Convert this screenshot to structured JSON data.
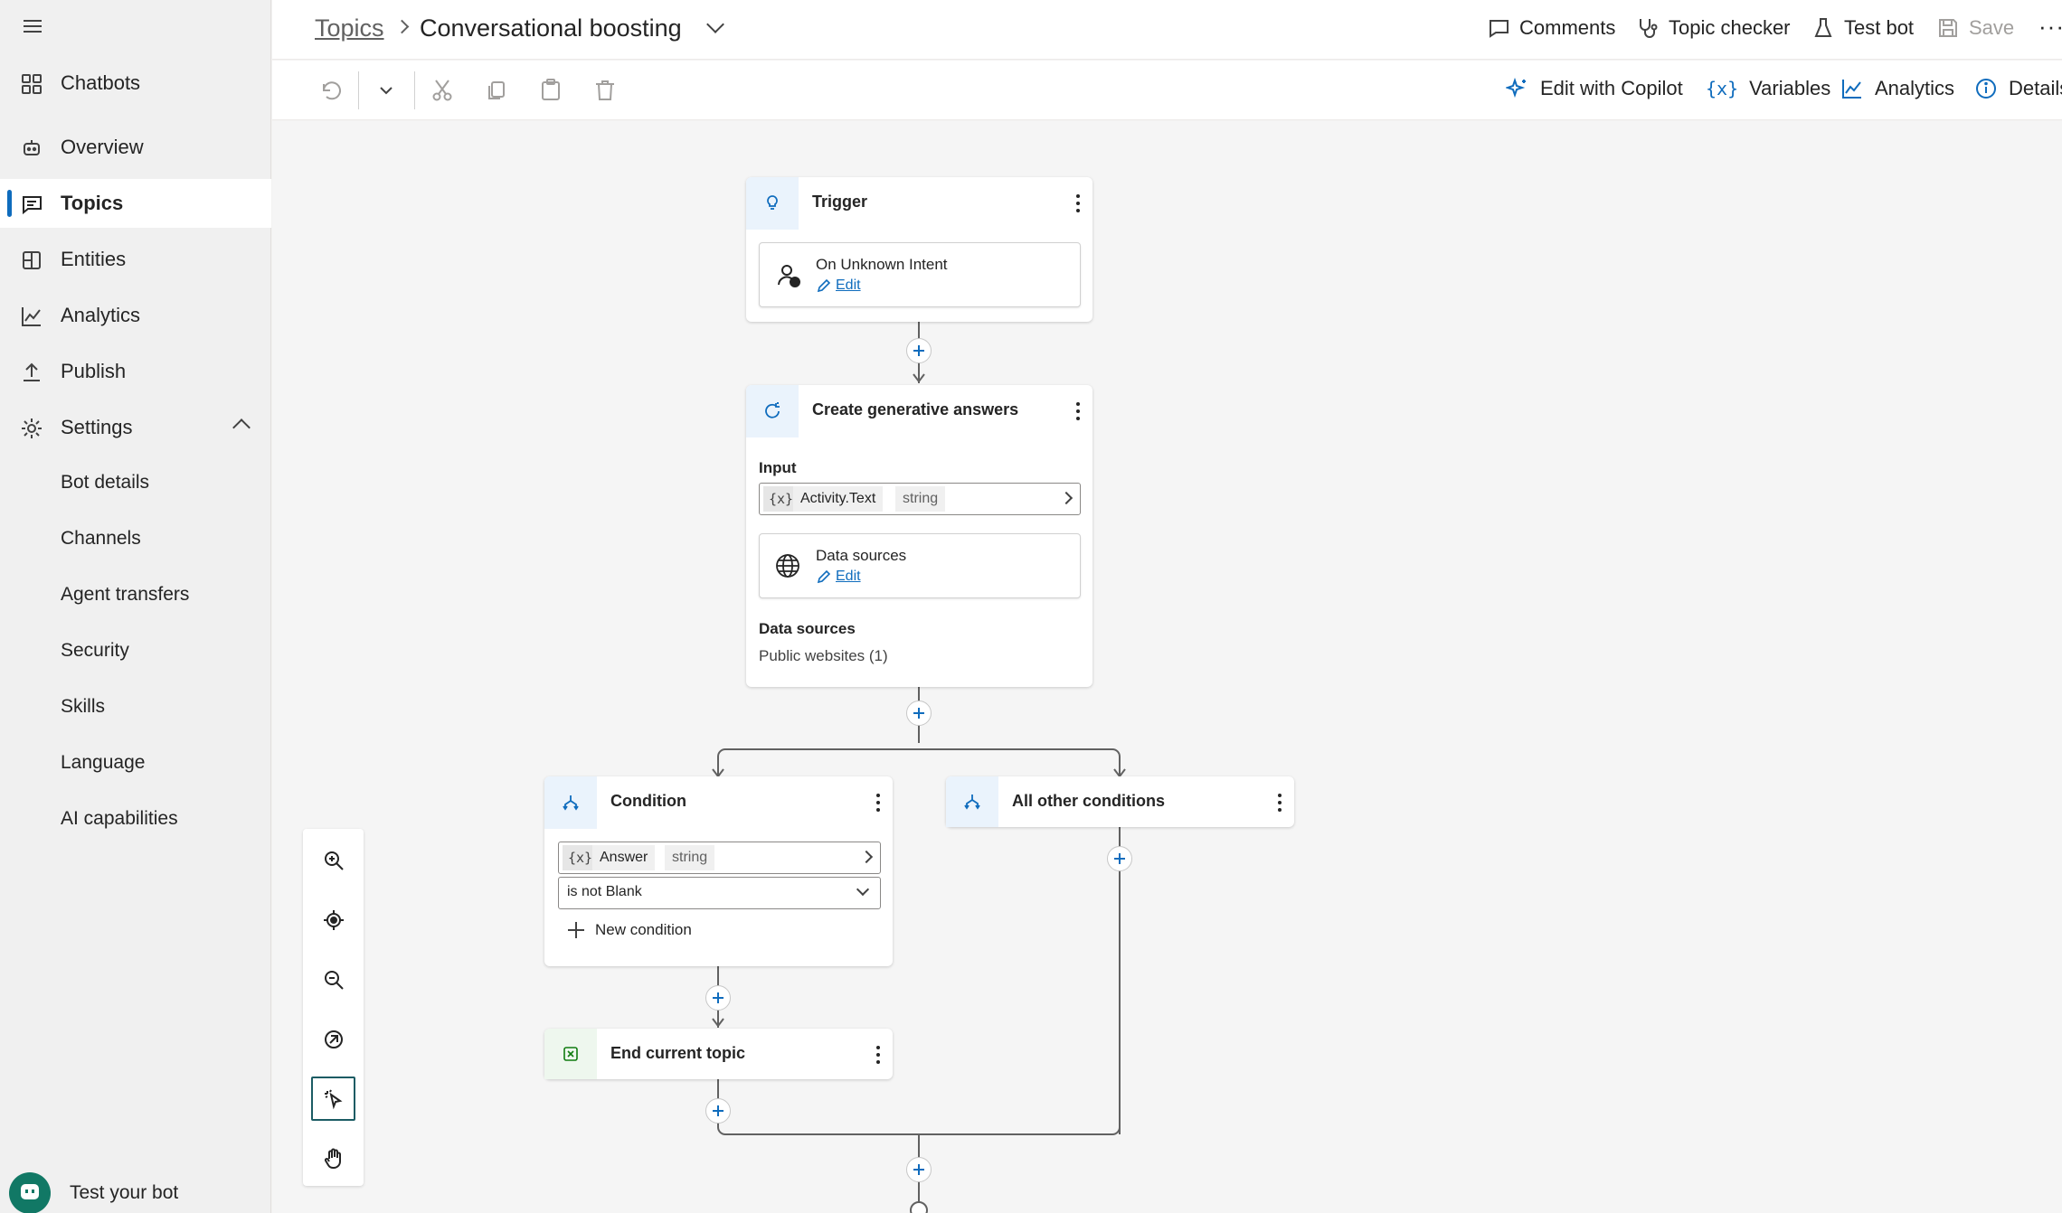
{
  "sidebar": {
    "items": [
      {
        "label": "Chatbots",
        "icon": "apps-grid-icon"
      },
      {
        "label": "Overview",
        "icon": "bot-icon"
      },
      {
        "label": "Topics",
        "icon": "chat-icon"
      },
      {
        "label": "Entities",
        "icon": "entities-icon"
      },
      {
        "label": "Analytics",
        "icon": "analytics-icon"
      },
      {
        "label": "Publish",
        "icon": "upload-icon"
      },
      {
        "label": "Settings",
        "icon": "gear-icon"
      }
    ],
    "settings_sub": [
      "Bot details",
      "Channels",
      "Agent transfers",
      "Security",
      "Skills",
      "Language",
      "AI capabilities"
    ],
    "test_bot_label": "Test your bot"
  },
  "header": {
    "breadcrumb_root": "Topics",
    "title": "Conversational boosting",
    "actions": {
      "comments": "Comments",
      "topic_checker": "Topic checker",
      "test_bot": "Test bot",
      "save": "Save"
    }
  },
  "toolbar": {
    "edit_with_copilot": "Edit with Copilot",
    "variables": "Variables",
    "analytics": "Analytics",
    "details": "Details"
  },
  "canvas": {
    "trigger": {
      "title": "Trigger",
      "card_title": "On Unknown Intent",
      "edit": "Edit"
    },
    "generative": {
      "title": "Create generative answers",
      "input_label": "Input",
      "var_x": "{x}",
      "var_name": "Activity.Text",
      "var_type": "string",
      "ds_card_title": "Data sources",
      "ds_card_edit": "Edit",
      "ds_label": "Data sources",
      "ds_value": "Public websites (1)"
    },
    "condition": {
      "title": "Condition",
      "var_x": "{x}",
      "var_name": "Answer",
      "var_type": "string",
      "operator": "is not Blank",
      "new_condition": "New condition"
    },
    "other": {
      "title": "All other conditions"
    },
    "end": {
      "title": "End current topic"
    }
  },
  "colors": {
    "accent": "#0f6cbd",
    "active_nav_bg": "#ffffff",
    "test_bot_bubble": "#117865",
    "node_icon_bg": "#eaf3fc"
  }
}
